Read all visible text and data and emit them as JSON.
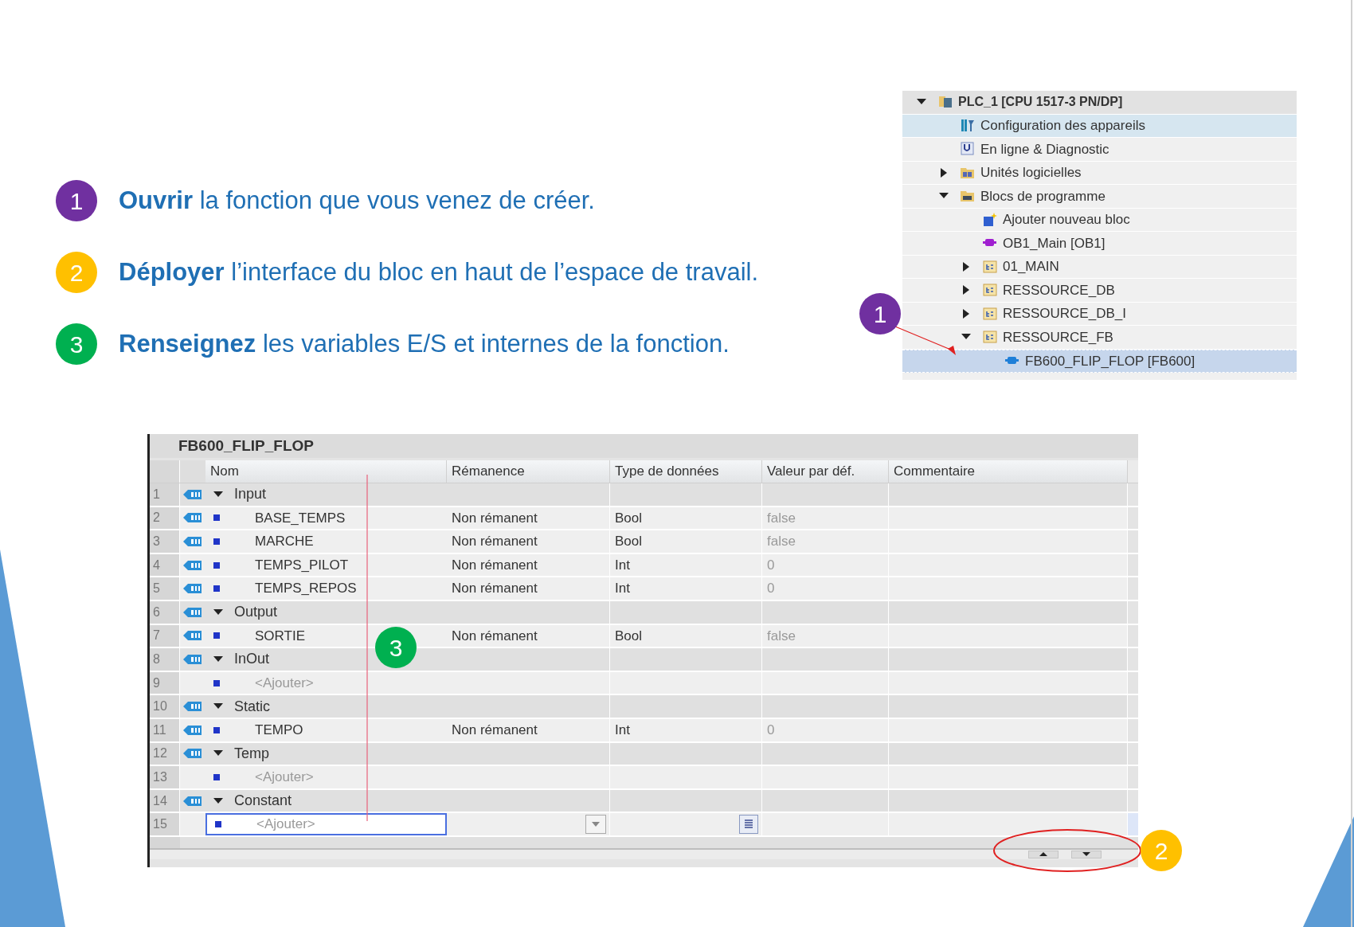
{
  "steps": [
    {
      "number": "1",
      "color": "#7030a0",
      "text": "**Ouvrir** la fonction que vous venez de créer."
    },
    {
      "number": "2",
      "color": "#ffc000",
      "text": "**Déployer** l’interface du bloc en haut de l’espace de travail."
    },
    {
      "number": "3",
      "color": "#00b050",
      "text": "**Renseignez** les variables E/S et internes de la fonction."
    }
  ],
  "project_tree": [
    {
      "label": "PLC_1 [CPU 1517-3 PN/DP]",
      "kind": "plc",
      "expanded": true,
      "selected": false,
      "hovered": false,
      "children": [
        {
          "label": "Configuration des appareils",
          "kind": "config",
          "selected": false,
          "hovered": true
        },
        {
          "label": "En ligne & Diagnostic",
          "kind": "diagnostic",
          "selected": false,
          "hovered": false
        },
        {
          "label": "Unités logicielles",
          "kind": "units",
          "expanded": false,
          "selected": false,
          "hovered": false
        },
        {
          "label": "Blocs de programme",
          "kind": "blocks",
          "expanded": true,
          "selected": false,
          "hovered": false,
          "children": [
            {
              "label": "Ajouter nouveau bloc",
              "kind": "add",
              "selected": false,
              "hovered": false
            },
            {
              "label": "OB1_Main [OB1]",
              "kind": "ob",
              "selected": false,
              "hovered": false
            },
            {
              "label": "01_MAIN",
              "kind": "group",
              "expanded": false,
              "selected": false,
              "hovered": false
            },
            {
              "label": "RESSOURCE_DB",
              "kind": "group",
              "expanded": false,
              "selected": false,
              "hovered": false
            },
            {
              "label": "RESSOURCE_DB_I",
              "kind": "group",
              "expanded": false,
              "selected": false,
              "hovered": false
            },
            {
              "label": "RESSOURCE_FB",
              "kind": "group",
              "expanded": true,
              "selected": false,
              "hovered": false,
              "children": [
                {
                  "label": "FB600_FLIP_FLOP [FB600]",
                  "kind": "fb",
                  "selected": true,
                  "hovered": false
                }
              ]
            }
          ]
        }
      ]
    }
  ],
  "block_interface": {
    "title": "FB600_FLIP_FLOP",
    "columns": [
      "Nom",
      "Rémanence",
      "Type de données",
      "Valeur par déf.",
      "Commentaire"
    ],
    "rows": [
      {
        "number": "1",
        "kind": "section",
        "name": "Input",
        "expanded": true,
        "selected": false
      },
      {
        "number": "2",
        "kind": "variable",
        "name": "BASE_TEMPS",
        "remanence": "Non rémanent",
        "type": "Bool",
        "default": "false",
        "selected": false
      },
      {
        "number": "3",
        "kind": "variable",
        "name": "MARCHE",
        "remanence": "Non rémanent",
        "type": "Bool",
        "default": "false",
        "selected": false
      },
      {
        "number": "4",
        "kind": "variable",
        "name": "TEMPS_PILOT",
        "remanence": "Non rémanent",
        "type": "Int",
        "default": "0",
        "selected": false
      },
      {
        "number": "5",
        "kind": "variable",
        "name": "TEMPS_REPOS",
        "remanence": "Non rémanent",
        "type": "Int",
        "default": "0",
        "selected": false
      },
      {
        "number": "6",
        "kind": "section",
        "name": "Output",
        "expanded": true,
        "selected": false
      },
      {
        "number": "7",
        "kind": "variable",
        "name": "SORTIE",
        "remanence": "Non rémanent",
        "type": "Bool",
        "default": "false",
        "selected": false
      },
      {
        "number": "8",
        "kind": "section",
        "name": "InOut",
        "expanded": true,
        "selected": false
      },
      {
        "number": "9",
        "kind": "add",
        "name": "<Ajouter>",
        "selected": false
      },
      {
        "number": "10",
        "kind": "section",
        "name": "Static",
        "expanded": true,
        "selected": false
      },
      {
        "number": "11",
        "kind": "variable",
        "name": "TEMPO",
        "remanence": "Non rémanent",
        "type": "Int",
        "default": "0",
        "selected": false
      },
      {
        "number": "12",
        "kind": "section",
        "name": "Temp",
        "expanded": true,
        "selected": false
      },
      {
        "number": "13",
        "kind": "add",
        "name": "<Ajouter>",
        "selected": false
      },
      {
        "number": "14",
        "kind": "section",
        "name": "Constant",
        "expanded": true,
        "selected": false
      },
      {
        "number": "15",
        "kind": "add",
        "name": "<Ajouter>",
        "selected": true
      }
    ]
  },
  "callouts": [
    {
      "number": "1",
      "color": "#7030a0"
    },
    {
      "number": "3",
      "color": "#00b050"
    },
    {
      "number": "2",
      "color": "#ffc000"
    }
  ]
}
